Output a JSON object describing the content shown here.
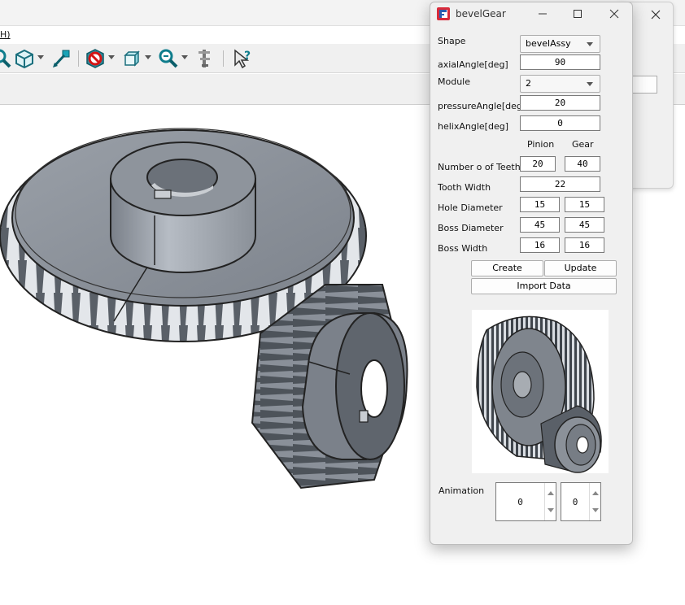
{
  "menu": {
    "help_fragment": "H)"
  },
  "background_dialog": {
    "button_fragment": "y"
  },
  "toolbar": {
    "icons": [
      "zoom-fit-icon",
      "view-cube-icon",
      "measure-pick-icon",
      "no-entry-icon",
      "box-view-icon",
      "zoom-icon",
      "caliper-icon",
      "whats-this-icon"
    ]
  },
  "dialog": {
    "title": "bevelGear",
    "labels": {
      "shape": "Shape",
      "axial_angle": "axialAngle[deg]",
      "module": "Module",
      "pressure_angle": "pressureAngle[deg]",
      "helix_angle": "helixAngle[deg]",
      "col_pinion": "Pinion",
      "col_gear": "Gear",
      "teeth": "Number o of Teeth",
      "tooth_width": "Tooth Width",
      "hole_diameter": "Hole Diameter",
      "boss_diameter": "Boss Diameter",
      "boss_width": "Boss Width",
      "animation": "Animation"
    },
    "values": {
      "shape": "bevelAssy",
      "axial_angle": "90",
      "module": "2",
      "pressure_angle": "20",
      "helix_angle": "0",
      "teeth_pinion": "20",
      "teeth_gear": "40",
      "tooth_width": "22",
      "hole_pinion": "15",
      "hole_gear": "15",
      "boss_pinion": "45",
      "boss_gear": "45",
      "bosswidth_pinion": "16",
      "bosswidth_gear": "16",
      "animation_a": "0",
      "animation_b": "0"
    },
    "buttons": {
      "create": "Create",
      "update": "Update",
      "import": "Import Data"
    }
  }
}
